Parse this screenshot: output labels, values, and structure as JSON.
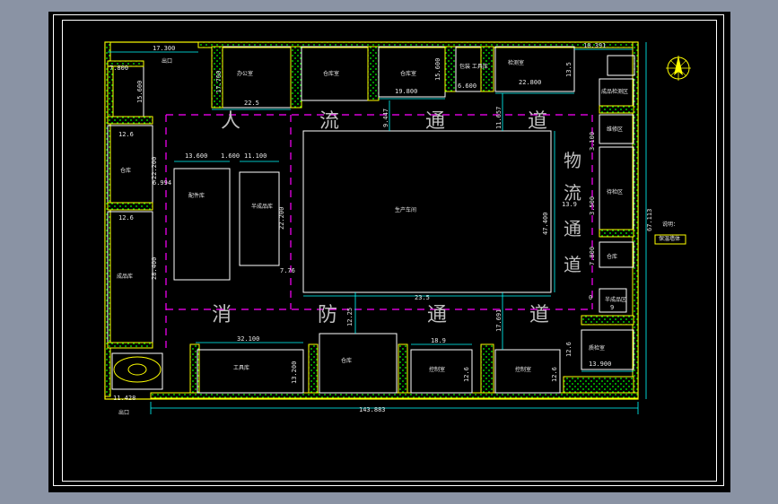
{
  "drawing": {
    "overall_width": "143.883",
    "right_height": "67.113"
  },
  "dimensions": {
    "top_left_offset": "17.300",
    "top_right_offset": "10.391",
    "top_left_block": "7.800",
    "left_block_height": "15.600",
    "office_width": "22.5",
    "office_height": "17.700",
    "top_mid_width": "19.800",
    "top_mid_height": "15.600",
    "top_small_width": "6.600",
    "top_right_width": "22.800",
    "top_right_height": "13.5",
    "aisle_gap_a": "9.447",
    "aisle_gap_b": "11.657",
    "left_store_top": "12.6",
    "left_store_top_h": "22.200",
    "left_store_bottom": "12.6",
    "left_store_bottom_h": "28.400",
    "left_gap": "6.994",
    "mid_a": "13.600",
    "mid_gap": "1.600",
    "mid_b": "11.100",
    "mid_b_h": "22.200",
    "small_gap": "7.76",
    "center_width": "23.5",
    "center_height": "47.400",
    "center_right_gap": "13.9",
    "right_dims_a": "3.100",
    "right_dims_b": "3.500",
    "right_dims_c": "7.800",
    "right_small": "9",
    "bottom_a": "32.100",
    "bottom_a_h": "13.200",
    "bottom_b_gap": "12.25",
    "bottom_c": "18.9",
    "bottom_c_h": "12.6",
    "bottom_d_gap": "17.691",
    "bottom_d_h": "12.6",
    "bottom_e": "13.900",
    "bottom_e_h": "12.6",
    "bottom_left": "11.428",
    "right_zero": "0"
  },
  "labels": {
    "entrance_top": "出口",
    "exit_bottom": "出口",
    "office": "办公室",
    "top_room_b": "仓库室",
    "top_room_c": "仓库室",
    "top_room_d": "包装\n工具库",
    "top_room_e": "检测室",
    "left_upper": "仓库",
    "left_lower": "成品库",
    "mid_left": "配件库",
    "mid_right": "半成品库",
    "center": "生产车间",
    "right_a": "成品检测区",
    "right_b": "维修区",
    "right_c": "待检区",
    "right_d": "仓库",
    "right_e": "半成品区",
    "right_f": "质检室",
    "right_g": "检测车间",
    "bottom_a": "工具库",
    "bottom_b": "仓库",
    "bottom_c": "控制室",
    "bottom_d": "控制室",
    "legend": "说明：",
    "legend_item": "保温墙体"
  },
  "aisles": {
    "people_1": "人",
    "people_2": "流",
    "people_3": "通",
    "people_4": "道",
    "fire_1": "消",
    "fire_2": "防",
    "fire_3": "通",
    "fire_4": "道",
    "logistics_1": "物",
    "logistics_2": "流",
    "logistics_3": "通",
    "logistics_4": "道"
  },
  "colors": {
    "wall": "#ffff00",
    "room": "#ffffff",
    "dimension": "#00ffff",
    "aisle_line": "#ff00ff",
    "background": "#000000"
  }
}
